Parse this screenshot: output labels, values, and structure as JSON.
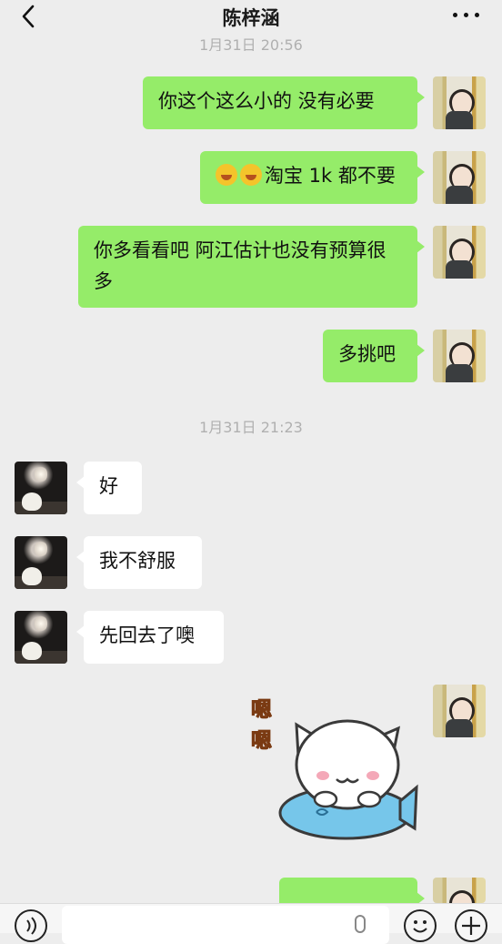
{
  "header": {
    "title": "陈梓涵"
  },
  "timestamps": [
    "1月31日 20:56",
    "1月31日 21:23"
  ],
  "messages": [
    {
      "from": "me",
      "text": "你这个这么小的 没有必要"
    },
    {
      "from": "me",
      "text": "淘宝 1k 都不要",
      "prefix_emoji": [
        "laughing-crying-emoji",
        "laughing-crying-emoji"
      ]
    },
    {
      "from": "me",
      "text": "你多看看吧 阿江估计也没有预算很多"
    },
    {
      "from": "me",
      "text": "多挑吧"
    },
    {
      "from": "other",
      "text": "好"
    },
    {
      "from": "other",
      "text": "我不舒服"
    },
    {
      "from": "other",
      "text": "先回去了噢"
    }
  ],
  "sticker": {
    "text": [
      "嗯",
      "嗯"
    ],
    "icon": "white-cat-on-blue-fish-sticker"
  },
  "colors": {
    "bubble_me": "#95ec69",
    "bubble_other": "#ffffff",
    "background": "#ededed"
  },
  "bottom_bar": {
    "icons": [
      "voice-icon",
      "mic-icon",
      "emoji-icon",
      "plus-icon"
    ]
  }
}
